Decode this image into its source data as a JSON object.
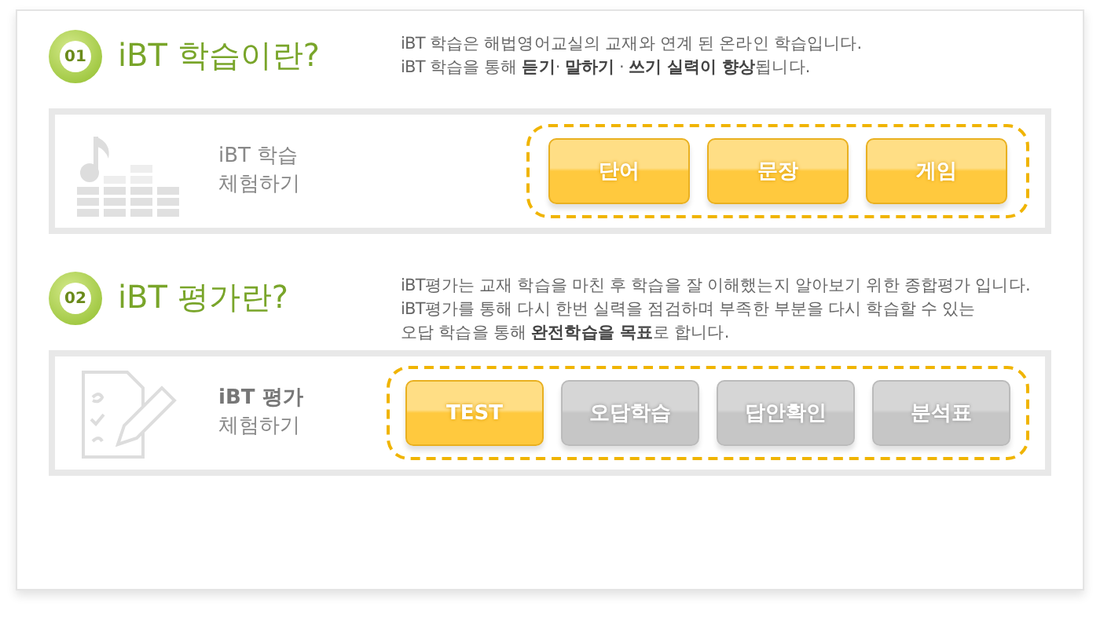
{
  "sections": [
    {
      "number": "01",
      "title": "iBT 학습이란?",
      "description": [
        "iBT 학습은 해법영어교실의 교재와 연계 된 온라인 학습입니다.",
        "iBT 학습을 통해 **듣기**· **말하기** · **쓰기 실력이 향상**됩니다."
      ],
      "panel": {
        "icon": {
          "kind": "music"
        },
        "label_line1": "iBT 학습",
        "label_line1_bold": false,
        "label_line2": "체험하기",
        "buttons": [
          {
            "label": "단어",
            "disabled": false
          },
          {
            "label": "문장",
            "disabled": false
          },
          {
            "label": "게임",
            "disabled": false
          }
        ]
      }
    },
    {
      "number": "02",
      "title": "iBT 평가란?",
      "description": [
        "iBT평가는 교재 학습을 마친 후 학습을 잘 이해했는지 알아보기 위한 종합평가 입니다.",
        "iBT평가를 통해 다시 한번 실력을 점검하며 부족한 부분을 다시 학습할 수 있는",
        "오답 학습을 통해 **완전학습을 목표**로 합니다."
      ],
      "panel": {
        "icon": {
          "kind": "pencil"
        },
        "label_line1": "iBT 평가",
        "label_line1_bold": true,
        "label_line2": "체험하기",
        "buttons": [
          {
            "label": "TEST",
            "disabled": false
          },
          {
            "label": "오답학습",
            "disabled": true
          },
          {
            "label": "답안확인",
            "disabled": true
          },
          {
            "label": "분석표",
            "disabled": true
          }
        ]
      }
    }
  ]
}
